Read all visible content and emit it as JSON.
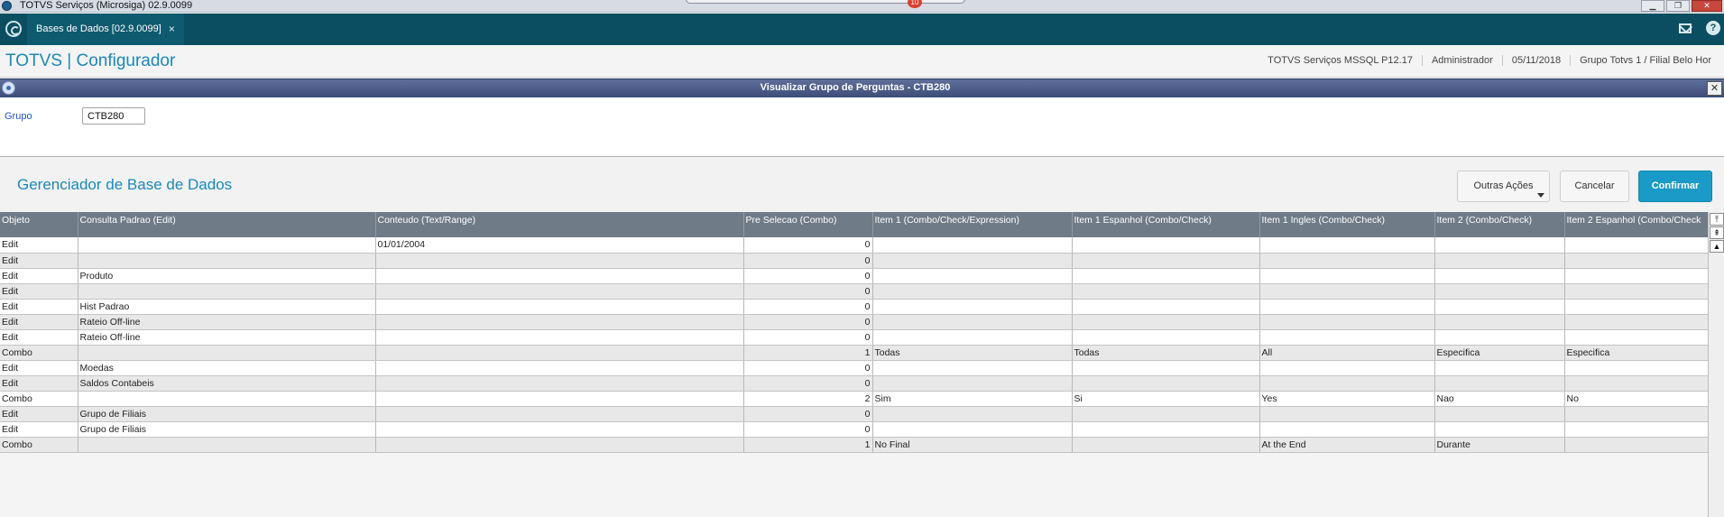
{
  "window": {
    "title": "TOTVS Serviços (Microsiga) 02.9.0099",
    "notification_count": "10",
    "minimize": "▁",
    "restore": "❐",
    "close": "✕"
  },
  "tabbar": {
    "tab_label": "Bases de Dados [02.9.0099]",
    "tab_close": "×",
    "help": "?"
  },
  "header": {
    "brand": "TOTVS | Configurador",
    "server": "TOTVS Serviços MSSQL P12.17",
    "user": "Administrador",
    "date": "05/11/2018",
    "company": "Grupo Totvs 1 / Filial Belo Hor"
  },
  "dialog": {
    "title": "Visualizar Grupo de Perguntas - CTB280",
    "close": "✕"
  },
  "grupo": {
    "label": "Grupo",
    "value": "CTB280"
  },
  "section": {
    "title": "Gerenciador de Base de Dados",
    "outras_label": "Outras Ações",
    "cancel_label": "Cancelar",
    "confirm_label": "Confirmar"
  },
  "grid": {
    "columns": [
      "Objeto",
      "Consulta Padrao (Edit)",
      "Conteudo (Text/Range)",
      "Pre Selecao (Combo)",
      "Item 1 (Combo/Check/Expression)",
      "Item 1 Espanhol (Combo/Check)",
      "Item 1 Ingles (Combo/Check)",
      "Item 2 (Combo/Check)",
      "Item 2 Espanhol (Combo/Check"
    ],
    "rows": [
      [
        "Edit",
        "",
        "01/01/2004",
        "0",
        "",
        "",
        "",
        "",
        ""
      ],
      [
        "Edit",
        "",
        "",
        "0",
        "",
        "",
        "",
        "",
        ""
      ],
      [
        "Edit",
        "Produto",
        "",
        "0",
        "",
        "",
        "",
        "",
        ""
      ],
      [
        "Edit",
        "",
        "",
        "0",
        "",
        "",
        "",
        "",
        ""
      ],
      [
        "Edit",
        "Hist Padrao",
        "",
        "0",
        "",
        "",
        "",
        "",
        ""
      ],
      [
        "Edit",
        "Rateio Off-line",
        "",
        "0",
        "",
        "",
        "",
        "",
        ""
      ],
      [
        "Edit",
        "Rateio Off-line",
        "",
        "0",
        "",
        "",
        "",
        "",
        ""
      ],
      [
        "Combo",
        "",
        "",
        "1",
        "Todas",
        "Todas",
        "All",
        "Especifica",
        "Especifica"
      ],
      [
        "Edit",
        "Moedas",
        "",
        "0",
        "",
        "",
        "",
        "",
        ""
      ],
      [
        "Edit",
        "Saldos Contabeis",
        "",
        "0",
        "",
        "",
        "",
        "",
        ""
      ],
      [
        "Combo",
        "",
        "",
        "2",
        "Sim",
        "Si",
        "Yes",
        "Nao",
        "No"
      ],
      [
        "Edit",
        "Grupo de Filiais",
        "",
        "0",
        "",
        "",
        "",
        "",
        ""
      ],
      [
        "Edit",
        "Grupo de Filiais",
        "",
        "0",
        "",
        "",
        "",
        "",
        ""
      ],
      [
        "Combo",
        "",
        "",
        "1",
        "No Final",
        "",
        "At the End",
        "Durante",
        ""
      ]
    ]
  },
  "scrollbar": {
    "top": "⤒",
    "page_up": "⇞",
    "up": "▲"
  }
}
